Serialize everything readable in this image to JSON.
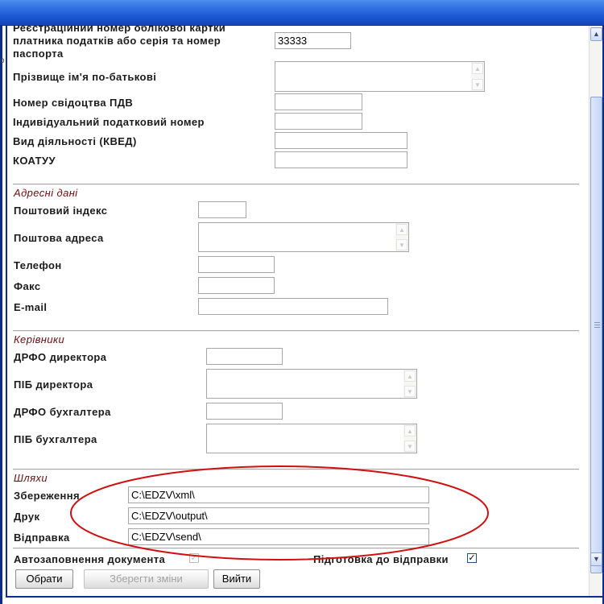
{
  "form": {
    "registration_label": "Реєстраційний номер облікової картки платника податків або серія та номер паспорта",
    "registration_value": "33333",
    "fullname_label": "Прізвище ім'я по-батькові",
    "vat_cert_label": "Номер свідоцтва ПДВ",
    "individual_tax_label": "Індивідуальний податковий номер",
    "activity_label": "Вид діяльності (КВЕД)",
    "koatuu_label": "КОАТУУ"
  },
  "address": {
    "section_title": "Адресні дані",
    "postal_code_label": "Поштовий індекс",
    "postal_address_label": "Поштова адреса",
    "phone_label": "Телефон",
    "fax_label": "Факс",
    "email_label": "E-mail"
  },
  "managers": {
    "section_title": "Керівники",
    "director_drfo_label": "ДРФО директора",
    "director_name_label": "ПІБ директора",
    "accountant_drfo_label": "ДРФО бухгалтера",
    "accountant_name_label": "ПІБ бухгалтера"
  },
  "paths": {
    "section_title": "Шляхи",
    "save_label": "Збереження",
    "save_value": "C:\\EDZV\\xml\\",
    "print_label": "Друк",
    "print_value": "C:\\EDZV\\output\\",
    "send_label": "Відправка",
    "send_value": "C:\\EDZV\\send\\"
  },
  "options": {
    "autofill_label": "Автозаповнення документа",
    "autofill_checked": true,
    "autofill_enabled": false,
    "prepare_send_label": "Підготовка до відправки",
    "prepare_send_checked": true
  },
  "buttons": {
    "select": "Обрати",
    "save_changes": "Зберегти зміни",
    "exit": "Вийти"
  },
  "colors": {
    "titlebar": "#2e6fe0",
    "section_title": "#6b0f0f",
    "annotation_ellipse": "#d01010"
  },
  "icons": {
    "check": "✓",
    "scroll_up": "▲",
    "scroll_down": "▼"
  }
}
